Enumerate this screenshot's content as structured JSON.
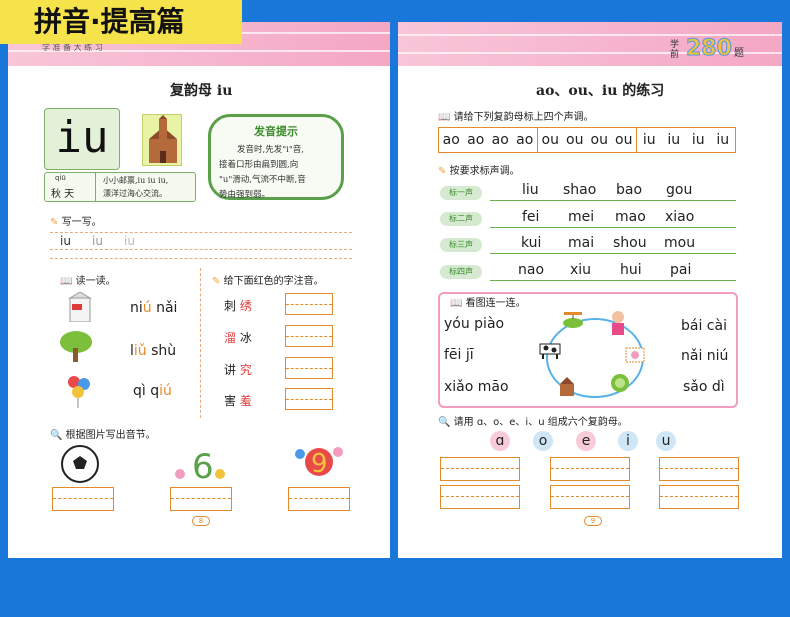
{
  "banner": "拼音·提高篇",
  "left": {
    "header": "学 准 备 大 练 习",
    "title": "复韵母 iu",
    "big_letter": "iu",
    "tip": {
      "heading": "发音提示",
      "line1": "发音时,先发\"i\"音,",
      "line2": "接着口形由扁到圆,向",
      "line3": "\"u\"滑动,气流不中断,音",
      "line4": "势由强到弱。"
    },
    "example": {
      "pinyin": "qiū",
      "word": "秋 天",
      "rhyme1": "小小邮票,iu iu iu,",
      "rhyme2": "漂洋过海心交流。"
    },
    "write": {
      "label": "写一写。",
      "samples": [
        "iu",
        "iu",
        "iu"
      ]
    },
    "read": {
      "label": "读一读。",
      "items": [
        {
          "a": "ni",
          "b": "ú",
          "c": " nǎi"
        },
        {
          "a": "l",
          "b": "iǔ",
          "c": " shù"
        },
        {
          "a": "qì q",
          "b": "iú",
          "c": ""
        }
      ]
    },
    "annotate": {
      "label": "给下面红色的字注音。",
      "rows": [
        {
          "black": "刺",
          "red": "绣",
          "red_first": false
        },
        {
          "black": "冰",
          "red": "溜",
          "red_first": true
        },
        {
          "black": "讲",
          "red": "究",
          "red_first": false
        },
        {
          "black": "害",
          "red": "羞",
          "red_first": false
        }
      ]
    },
    "pic_label": "根据图片写出音节。",
    "page_num": "8"
  },
  "right": {
    "header": "学前",
    "header_num": "280",
    "header_suffix": "题",
    "title": "ao、ou、iu 的练习",
    "tones_label": "请给下列复韵母标上四个声调。",
    "tone_groups": [
      [
        "ao",
        "ao",
        "ao",
        "ao"
      ],
      [
        "ou",
        "ou",
        "ou",
        "ou"
      ],
      [
        "iu",
        "iu",
        "iu",
        "iu"
      ]
    ],
    "by_tone_label": "按要求标声调。",
    "tone_rows": [
      {
        "tag": "标一声",
        "words": [
          "liu",
          "shao",
          "bao",
          "gou"
        ]
      },
      {
        "tag": "标二声",
        "words": [
          "fei",
          "mei",
          "mao",
          "xiao"
        ]
      },
      {
        "tag": "标三声",
        "words": [
          "kui",
          "mai",
          "shou",
          "mou"
        ]
      },
      {
        "tag": "标四声",
        "words": [
          "nao",
          "xiu",
          "hui",
          "pai"
        ]
      }
    ],
    "link_label": "看图连一连。",
    "link_left": [
      "yóu piào",
      "fēi jī",
      "xiǎo māo"
    ],
    "link_right": [
      "bái cài",
      "nǎi niú",
      "sǎo dì"
    ],
    "vowel_label": "请用 ɑ、o、e、i、u 组成六个复韵母。",
    "vowels": [
      "ɑ",
      "o",
      "e",
      "i",
      "u"
    ],
    "vowel_colors": [
      "#f9cbd9",
      "#cfe6f7",
      "#f9cbd9",
      "#cfe6f7",
      "#cfe6f7"
    ],
    "page_num": "9"
  }
}
